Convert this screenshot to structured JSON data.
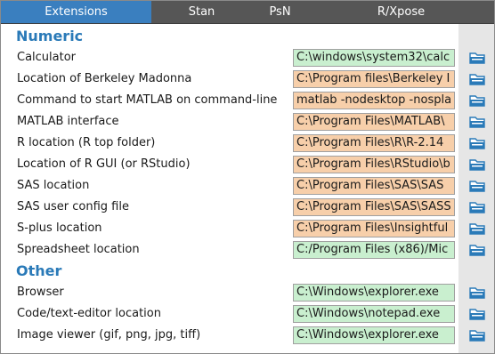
{
  "tabs": [
    {
      "label": "Extensions"
    },
    {
      "label": "Stan"
    },
    {
      "label": "PsN"
    },
    {
      "label": "R/Xpose"
    }
  ],
  "sections": [
    {
      "title": "Numeric",
      "rows": [
        {
          "label": "Calculator",
          "value": "C:\\windows\\system32\\calc",
          "color": "green"
        },
        {
          "label": "Location of Berkeley Madonna",
          "value": "C:\\Program files\\Berkeley I",
          "color": "orange"
        },
        {
          "label": "Command to start MATLAB on command-line",
          "value": "matlab -nodesktop -nospla",
          "color": "orange"
        },
        {
          "label": "MATLAB interface",
          "value": "C:\\Program Files\\MATLAB\\",
          "color": "orange"
        },
        {
          "label": "R location (R top folder)",
          "value": "C:\\Program Files\\R\\R-2.14",
          "color": "orange"
        },
        {
          "label": "Location of R GUI (or RStudio)",
          "value": "C:\\Program Files\\RStudio\\b",
          "color": "orange"
        },
        {
          "label": "SAS location",
          "value": "C:\\Program Files\\SAS\\SAS",
          "color": "orange"
        },
        {
          "label": "SAS user config file",
          "value": "C:\\Program Files\\SAS\\SASS",
          "color": "orange"
        },
        {
          "label": "S-plus location",
          "value": "C:\\Program Files\\Insightful",
          "color": "orange"
        },
        {
          "label": "Spreadsheet location",
          "value": "C:/Program Files (x86)/Mic",
          "color": "green"
        }
      ]
    },
    {
      "title": "Other",
      "rows": [
        {
          "label": "Browser",
          "value": "C:\\Windows\\explorer.exe",
          "color": "green"
        },
        {
          "label": "Code/text-editor location",
          "value": "C:\\Windows\\notepad.exe",
          "color": "green"
        },
        {
          "label": "Image viewer (gif, png, jpg, tiff)",
          "value": "C:\\Windows\\explorer.exe",
          "color": "green"
        }
      ]
    }
  ],
  "colors": {
    "accent": "#2a7ab8",
    "tab_active": "#3a7fbf",
    "tab_bar": "#565656",
    "field_green": "#c9efcf",
    "field_orange": "#f7cfaa",
    "folder_icon": "#2a7ab8"
  }
}
